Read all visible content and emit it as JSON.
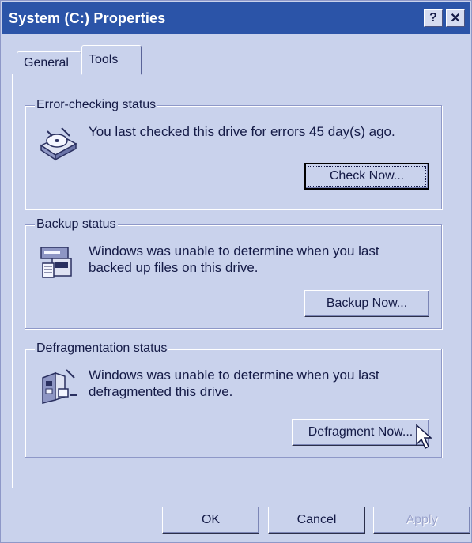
{
  "window": {
    "title": "System (C:) Properties",
    "help_button": "?",
    "close_button": "✕"
  },
  "tabs": [
    {
      "label": "General",
      "active": false
    },
    {
      "label": "Tools",
      "active": true
    }
  ],
  "sections": {
    "error_checking": {
      "legend": "Error-checking status",
      "message": "You last checked this drive for errors 45 day(s) ago.",
      "button_label": "Check Now...",
      "icon": "disk-check-icon"
    },
    "backup": {
      "legend": "Backup status",
      "message": "Windows was unable to determine when you last backed up files on this drive.",
      "button_label": "Backup Now...",
      "icon": "backup-icon"
    },
    "defrag": {
      "legend": "Defragmentation status",
      "message": "Windows was unable to determine when you last defragmented this drive.",
      "button_label": "Defragment Now...",
      "icon": "defrag-icon"
    }
  },
  "footer": {
    "ok_label": "OK",
    "cancel_label": "Cancel",
    "apply_label": "Apply"
  },
  "colors": {
    "titlebar": "#2b54a8",
    "dialog_face": "#c9d2ec",
    "text": "#141a46"
  }
}
